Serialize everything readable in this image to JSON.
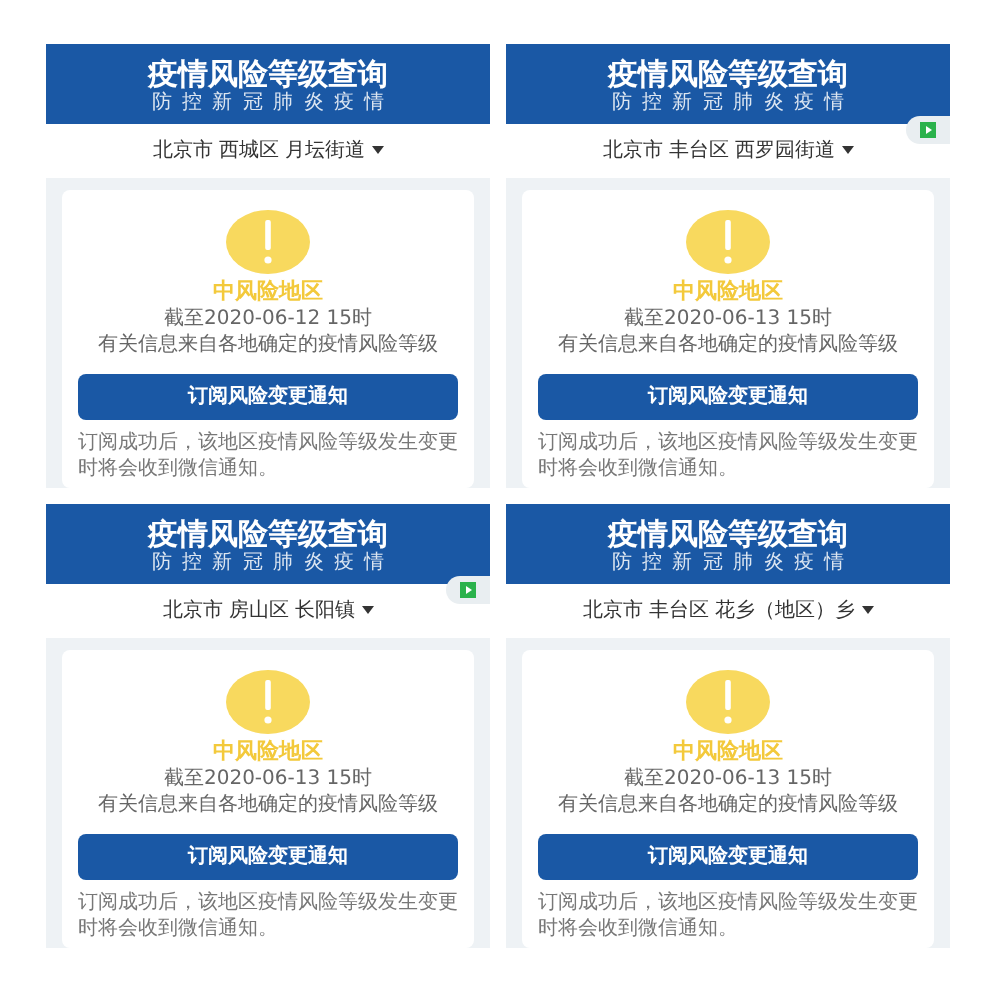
{
  "panels": [
    {
      "title": "疫情风险等级查询",
      "subtitle": "防 控 新 冠 肺 炎 疫 情",
      "side_tab": false,
      "location": "北京市 西城区 月坛街道",
      "level_label": "中风险地区",
      "updated": "截至2020-06-12 15时",
      "source": "有关信息来自各地确定的疫情风险等级",
      "button": "订阅风险变更通知",
      "note": "订阅成功后，该地区疫情风险等级发生变更时将会收到微信通知。"
    },
    {
      "title": "疫情风险等级查询",
      "subtitle": "防 控 新 冠 肺 炎 疫 情",
      "side_tab": true,
      "location": "北京市 丰台区 西罗园街道",
      "level_label": "中风险地区",
      "updated": "截至2020-06-13 15时",
      "source": "有关信息来自各地确定的疫情风险等级",
      "button": "订阅风险变更通知",
      "note": "订阅成功后，该地区疫情风险等级发生变更时将会收到微信通知。"
    },
    {
      "title": "疫情风险等级查询",
      "subtitle": "防 控 新 冠 肺 炎 疫 情",
      "side_tab": true,
      "location": "北京市 房山区 长阳镇",
      "level_label": "中风险地区",
      "updated": "截至2020-06-13 15时",
      "source": "有关信息来自各地确定的疫情风险等级",
      "button": "订阅风险变更通知",
      "note": "订阅成功后，该地区疫情风险等级发生变更时将会收到微信通知。"
    },
    {
      "title": "疫情风险等级查询",
      "subtitle": "防 控 新 冠 肺 炎 疫 情",
      "side_tab": false,
      "location": "北京市 丰台区 花乡（地区）乡",
      "level_label": "中风险地区",
      "updated": "截至2020-06-13 15时",
      "source": "有关信息来自各地确定的疫情风险等级",
      "button": "订阅风险变更通知",
      "note": "订阅成功后，该地区疫情风险等级发生变更时将会收到微信通知。"
    }
  ]
}
